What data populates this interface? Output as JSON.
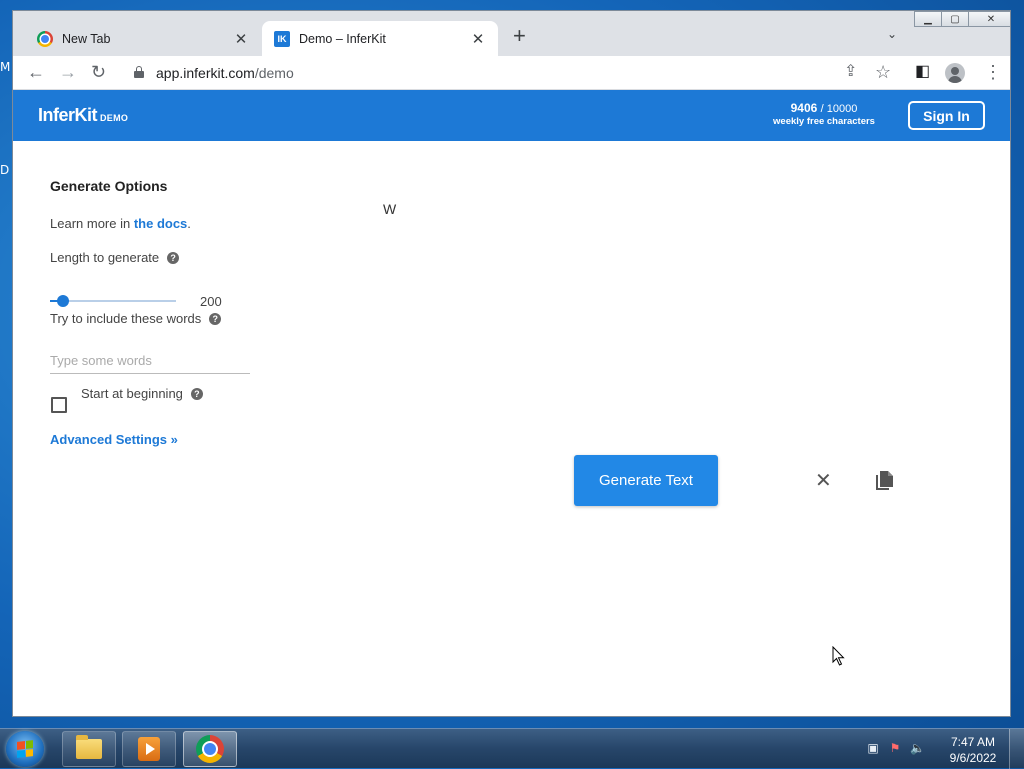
{
  "desktop": {
    "edge_letters": [
      "M",
      "D"
    ]
  },
  "browser": {
    "tabs": [
      {
        "title": "New Tab",
        "favicon": "chrome-icon",
        "active": false
      },
      {
        "title": "Demo – InferKit",
        "favicon": "inferkit-icon",
        "favicon_text": "IK",
        "active": true
      }
    ],
    "tab_close_glyph": "✕",
    "new_tab_glyph": "+",
    "tab_search_glyph": "⌄",
    "window_controls": {
      "minimize": "▁",
      "maximize": "▢",
      "close": "✕"
    },
    "nav": {
      "back": "←",
      "forward": "→",
      "reload": "↻"
    },
    "url_host": "app.inferkit.com",
    "url_path": "/demo",
    "toolbar_icons": {
      "share": "⇪",
      "bookmark": "☆",
      "side_panel": "◧",
      "menu": "⋮"
    }
  },
  "header": {
    "logo": "InferKit",
    "logo_sub": "DEMO",
    "char_used": "9406",
    "char_total": "/ 10000",
    "char_caption": "weekly free characters",
    "sign_in": "Sign In",
    "color": "#1d79d6"
  },
  "options": {
    "title": "Generate Options",
    "docs_prefix": "Learn more in ",
    "docs_link": "the docs",
    "docs_suffix": ".",
    "length_label": "Length to generate",
    "length_value": "200",
    "length_slider_fraction": 0.1,
    "words_label": "Try to include these words",
    "words_placeholder": "Type some words",
    "words_value": "",
    "start_label": "Start at beginning",
    "start_checked": false,
    "advanced": "Advanced Settings »",
    "help_glyph": "?"
  },
  "editor": {
    "prompt_text": "W",
    "generate_button": "Generate Text",
    "clear_glyph": "✕"
  },
  "taskbar": {
    "apps": [
      "folder-icon",
      "media-player-icon",
      "chrome-icon"
    ],
    "time": "7:47 AM",
    "date": "9/6/2022"
  }
}
